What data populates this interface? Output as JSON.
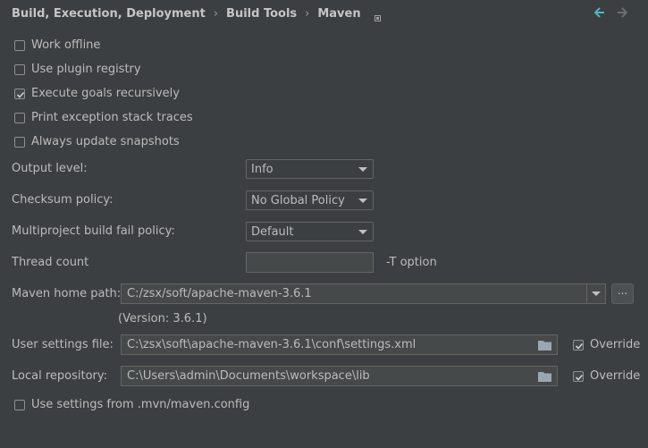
{
  "breadcrumb": {
    "items": [
      "Build, Execution, Deployment",
      "Build Tools",
      "Maven"
    ],
    "separator": "›"
  },
  "options": [
    {
      "label": "Work offline",
      "checked": false
    },
    {
      "label": "Use plugin registry",
      "checked": false
    },
    {
      "label": "Execute goals recursively",
      "checked": true
    },
    {
      "label": "Print exception stack traces",
      "checked": false
    },
    {
      "label": "Always update snapshots",
      "checked": false
    }
  ],
  "output_level": {
    "label": "Output level:",
    "value": "Info"
  },
  "checksum_policy": {
    "label": "Checksum policy:",
    "value": "No Global Policy"
  },
  "fail_policy": {
    "label": "Multiproject build fail policy:",
    "value": "Default"
  },
  "thread_count": {
    "label": "Thread count",
    "value": "",
    "suffix": "-T option"
  },
  "maven_home": {
    "label": "Maven home path:",
    "value": "C:/zsx/soft/apache-maven-3.6.1",
    "version": "(Version: 3.6.1)",
    "browse": "..."
  },
  "user_settings": {
    "label": "User settings file:",
    "value": "C:\\zsx\\soft\\apache-maven-3.6.1\\conf\\settings.xml",
    "override_label": "Override",
    "override_checked": true
  },
  "local_repo": {
    "label": "Local repository:",
    "value": "C:\\Users\\admin\\Documents\\workspace\\lib",
    "override_label": "Override",
    "override_checked": true
  },
  "mvn_config": {
    "label": "Use settings from .mvn/maven.config",
    "checked": false
  },
  "colors": {
    "background": "#3c3f41",
    "text": "#bbbbbb",
    "nav_back": "#4fb3c1",
    "nav_forward": "#6e6e6e"
  },
  "icons": {
    "pin": "pin-icon",
    "back": "arrow-left-icon",
    "forward": "arrow-right-icon",
    "folder": "folder-icon",
    "checkmark": "check-icon"
  }
}
